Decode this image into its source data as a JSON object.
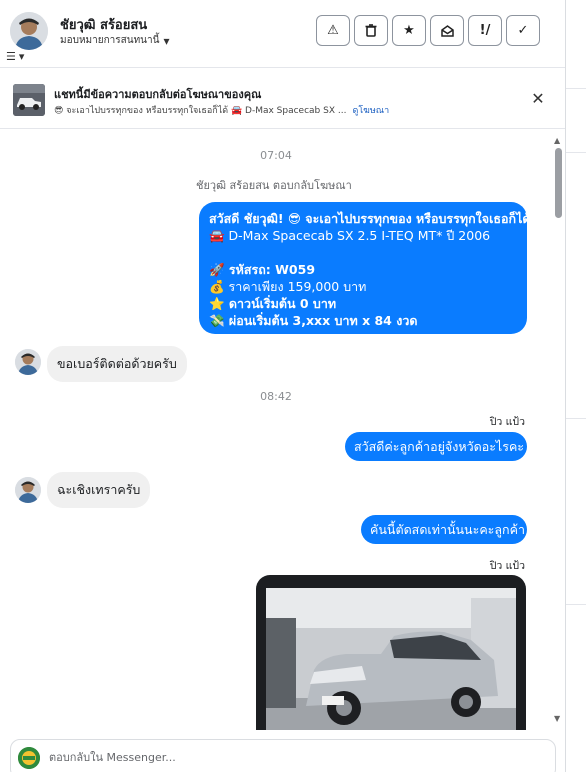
{
  "header": {
    "contact_name": "ชัยวุฒิ สร้อยสน",
    "assign_label": "มอบหมายการสนทนานี้",
    "actions": [
      {
        "name": "spam-button",
        "glyph": "⚠"
      },
      {
        "name": "delete-button",
        "glyph": "🗑"
      },
      {
        "name": "star-button",
        "glyph": "★"
      },
      {
        "name": "mark-unread-button",
        "glyph": "✉"
      },
      {
        "name": "follow-up-button",
        "glyph": "!/"
      },
      {
        "name": "done-button",
        "glyph": "✓"
      }
    ]
  },
  "ad_banner": {
    "title": "แชทนี้มีข้อความตอบกลับต่อโฆษณาของคุณ",
    "subtitle": "😎 จะเอาไปบรรทุกของ หรือบรรทุกใจเธอก็ได้ 🚘 D-Max Spacecab SX ...",
    "link": "ดูโฆษณา"
  },
  "chat": {
    "time1": "07:04",
    "ad_reply_note": "ชัยวุฒิ สร้อยสน ตอบกลับโฆษณา",
    "ad_message_lines": [
      "สวัสดี ชัยวุฒิ! 😎 จะเอาไปบรรทุกของ หรือบรรทุกใจเธอก็ได้",
      "🚘 D-Max Spacecab SX 2.5 I-TEQ MT* ปี 2006",
      "",
      "🚀 รหัสรถ: W059",
      "💰 ราคาเพียง 159,000 บาท",
      "⭐ ดาวน์เริ่มต้น 0 บาท",
      "💸 ผ่อนเริ่มต้น 3,xxx บาท x 84 งวด"
    ],
    "in_msg_1": "ขอเบอร์ติดต่อด้วยครับ",
    "time2": "08:42",
    "sender_1": "ปิว แป้ว",
    "out_msg_1": "สวัสดีค่ะลูกค้าอยู่จังหวัดอะไรคะ",
    "in_msg_2": "ฉะเชิงเทราครับ",
    "out_msg_2": "คันนี้ตัดสดเท่านั้นนะคะลูกค้า",
    "sender_2": "ปิว แป้ว"
  },
  "composer": {
    "placeholder": "ตอบกลับใน Messenger..."
  },
  "colors": {
    "accent": "#0a7cff",
    "incoming_bubble": "#f0f0f0"
  }
}
